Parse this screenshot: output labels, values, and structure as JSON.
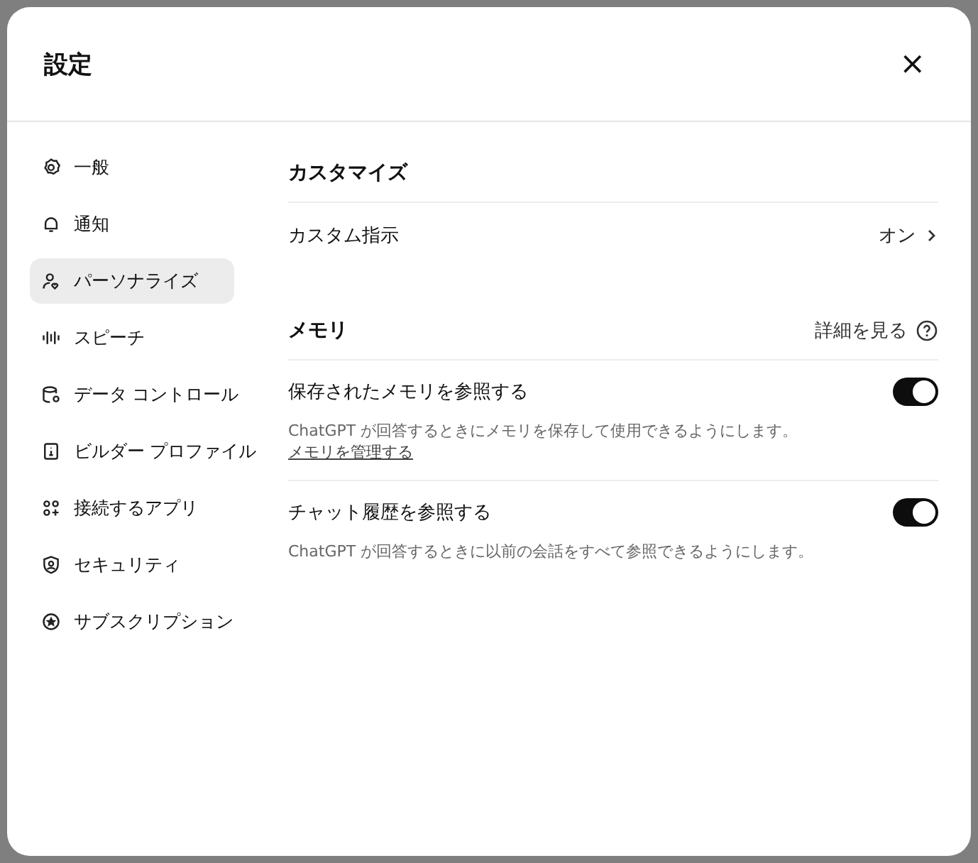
{
  "dialog": {
    "title": "設定",
    "close": "×"
  },
  "sidebar": {
    "items": [
      {
        "label": "一般",
        "selected": false
      },
      {
        "label": "通知",
        "selected": false
      },
      {
        "label": "パーソナライズ",
        "selected": true
      },
      {
        "label": "スピーチ",
        "selected": false
      },
      {
        "label": "データ コントロール",
        "selected": false
      },
      {
        "label": "ビルダー プロファイル",
        "selected": false
      },
      {
        "label": "接続するアプリ",
        "selected": false
      },
      {
        "label": "セキュリティ",
        "selected": false
      },
      {
        "label": "サブスクリプション",
        "selected": false
      }
    ]
  },
  "customize": {
    "heading": "カスタマイズ",
    "row": {
      "label": "カスタム指示",
      "value": "オン"
    }
  },
  "memory": {
    "heading": "メモリ",
    "details_link": "詳細を見る",
    "items": [
      {
        "label": "保存されたメモリを参照する",
        "on": true,
        "description": "ChatGPT が回答するときにメモリを保存して使用できるようにします。",
        "link": "メモリを管理する"
      },
      {
        "label": "チャット履歴を参照する",
        "on": true,
        "description": "ChatGPT が回答するときに以前の会話をすべて参照できるようにします。"
      }
    ]
  }
}
